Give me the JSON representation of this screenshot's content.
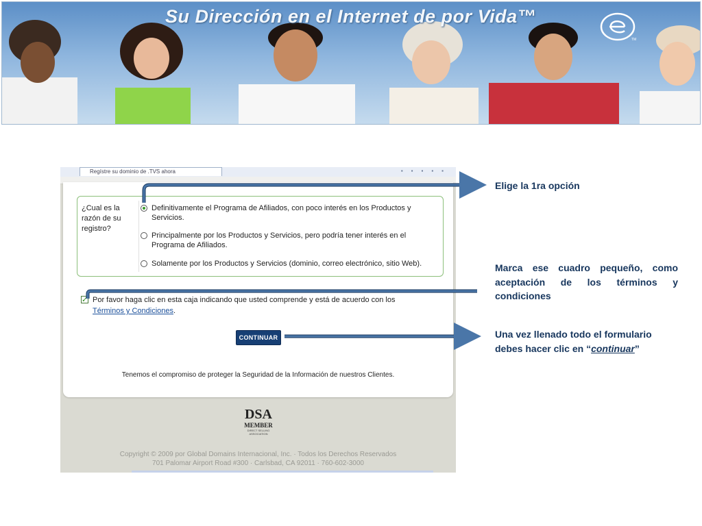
{
  "banner": {
    "title": "Su Dirección en el Internet de por Vida™",
    "logo_icon": "e-circle-logo-icon"
  },
  "browser": {
    "tab_title": "Regístre su dominio de .TVS ahora"
  },
  "form": {
    "question": "¿Cual es la razón de su registro?",
    "options": [
      {
        "text": "Definitivamente el Programa de Afiliados, con poco interés en los Productos y Servicios.",
        "selected": true
      },
      {
        "text": "Principalmente por los Productos y Servicios, pero podría tener interés en el Programa de Afiliados.",
        "selected": false
      },
      {
        "text": "Solamente por los Productos y Servicios (dominio, correo electrónico, sitio Web).",
        "selected": false
      }
    ],
    "terms_text": "Por favor haga clic en esta caja indicando que usted comprende y está de acuerdo con los ",
    "terms_link": "Términos y Condiciones",
    "terms_end": ".",
    "terms_checked": true,
    "continue_label": "CONTINUAR",
    "security_text": "Tenemos el compromiso de proteger la Seguridad de la Información de nuestros Clientes."
  },
  "footer": {
    "dsa_mark": "DSA",
    "dsa_member": "MEMBER",
    "dsa_small": "DIRECT SELLING ASSOCIATION",
    "copyright_line1": "Copyright © 2009 por Global Domains Internacional, Inc. · Todos los Derechos Reservados",
    "copyright_line2": "701 Palomar Airport Road #300 · Carlsbad, CA 92011 · 760-602-3000"
  },
  "annotations": {
    "note1": "Elige la 1ra opción",
    "note2": "Marca ese cuadro pequeño, como aceptación de los términos y condiciones",
    "note3_prefix": "Una vez llenado todo el formulario debes hacer clic en “",
    "note3_emph": "continuar",
    "note3_suffix": "”"
  },
  "colors": {
    "arrow": "#4a76a8",
    "annotation_text": "#17365d",
    "button": "#173f74",
    "box_border": "#8cbf7a"
  }
}
